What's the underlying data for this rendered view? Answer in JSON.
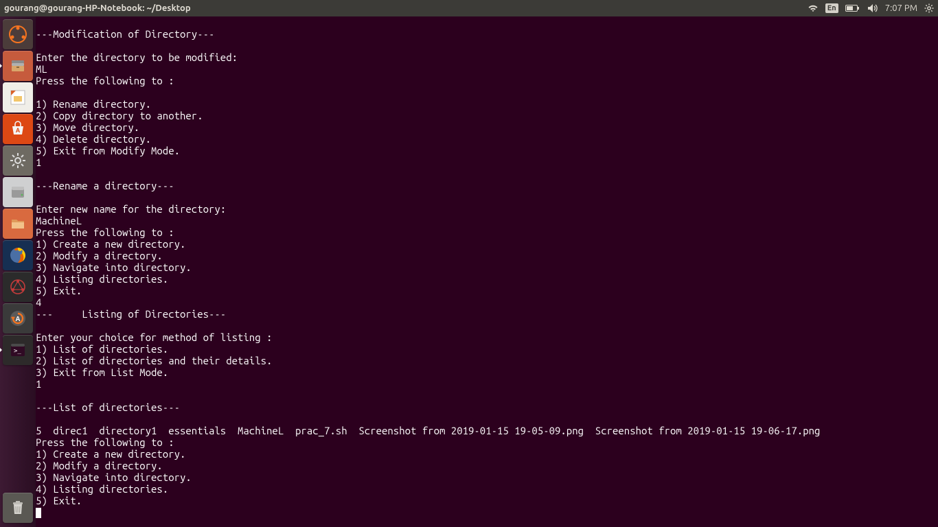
{
  "topbar": {
    "title": "gourang@gourang-HP-Notebook: ~/Desktop",
    "lang": "En",
    "time": "7:07 PM"
  },
  "launcher": {
    "tiles": [
      {
        "name": "ubuntu-dash",
        "bg": "#4b3c3a"
      },
      {
        "name": "files-nautilus",
        "bg": "#e1755a"
      },
      {
        "name": "libreoffice-impress",
        "bg": "#f0eee8"
      },
      {
        "name": "ubuntu-software",
        "bg": "#dd4814"
      },
      {
        "name": "settings",
        "bg": "#6e6a62"
      },
      {
        "name": "disks",
        "bg": "#cfd0d1"
      },
      {
        "name": "file-manager",
        "bg": "#d96a3f"
      },
      {
        "name": "firefox",
        "bg": "#1d3b66"
      },
      {
        "name": "network",
        "bg": "#2b2b2b"
      },
      {
        "name": "software-updater",
        "bg": "#3a3a3a"
      },
      {
        "name": "terminal",
        "bg": "#2d2a2a"
      }
    ],
    "trash": {
      "name": "trash",
      "bg": "#5a5853"
    }
  },
  "terminal_lines": [
    "",
    "---Modification of Directory---",
    "",
    "Enter the directory to be modified:",
    "ML",
    "Press the following to :",
    "",
    "1) Rename directory.",
    "2) Copy directory to another.",
    "3) Move directory.",
    "4) Delete directory.",
    "5) Exit from Modify Mode.",
    "1",
    "",
    "---Rename a directory---",
    "",
    "Enter new name for the directory:",
    "MachineL",
    "Press the following to :",
    "1) Create a new directory.",
    "2) Modify a directory.",
    "3) Navigate into directory.",
    "4) Listing directories.",
    "5) Exit.",
    "4",
    "---     Listing of Directories---",
    "",
    "Enter your choice for method of listing :",
    "1) List of directories.",
    "2) List of directories and their details.",
    "3) Exit from List Mode.",
    "1",
    "",
    "---List of directories---",
    "",
    "5  direc1  directory1  essentials  MachineL  prac_7.sh  Screenshot from 2019-01-15 19-05-09.png  Screenshot from 2019-01-15 19-06-17.png",
    "Press the following to :",
    "1) Create a new directory.",
    "2) Modify a directory.",
    "3) Navigate into directory.",
    "4) Listing directories.",
    "5) Exit."
  ]
}
